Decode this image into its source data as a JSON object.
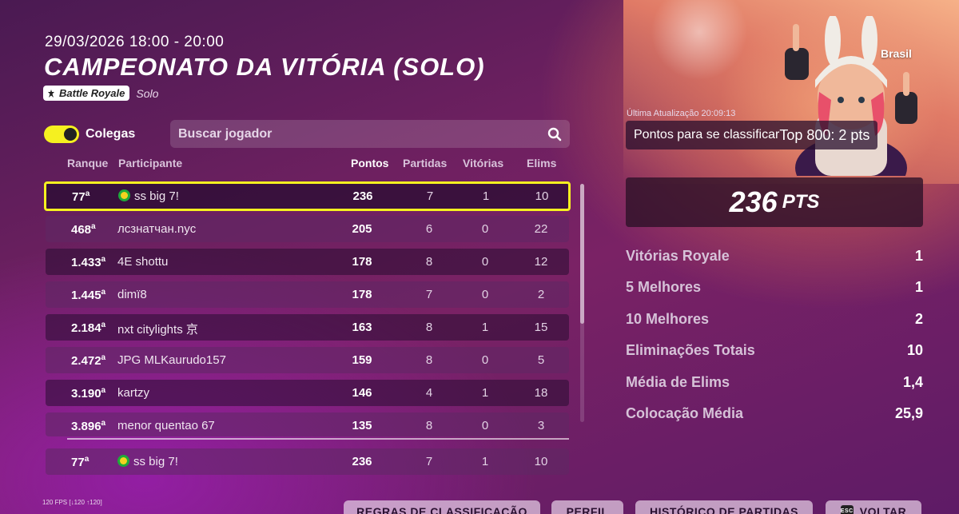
{
  "event": {
    "date": "29/03/2026 18:00 - 20:00",
    "title": "CAMPEONATO DA VITÓRIA (SOLO)",
    "mode_badge": "Battle Royale",
    "mode_sub": "Solo"
  },
  "filters": {
    "toggle_label": "Colegas",
    "toggle_on": true,
    "search_placeholder": "Buscar jogador"
  },
  "table": {
    "headers": {
      "rank": "Ranque",
      "participant": "Participante",
      "points": "Pontos",
      "matches": "Partidas",
      "wins": "Vitórias",
      "elims": "Elims"
    },
    "rows": [
      {
        "rank": "77",
        "name": "ss big 7!",
        "points": "236",
        "matches": "7",
        "wins": "1",
        "elims": "10"
      },
      {
        "rank": "468",
        "name": "лсзнатчан.nyc",
        "points": "205",
        "matches": "6",
        "wins": "0",
        "elims": "22"
      },
      {
        "rank": "1.433",
        "name": "4E shottu",
        "points": "178",
        "matches": "8",
        "wins": "0",
        "elims": "12"
      },
      {
        "rank": "1.445",
        "name": "dimï8",
        "points": "178",
        "matches": "7",
        "wins": "0",
        "elims": "2"
      },
      {
        "rank": "2.184",
        "name": "nxt citylights 京",
        "points": "163",
        "matches": "8",
        "wins": "1",
        "elims": "15"
      },
      {
        "rank": "2.472",
        "name": "JPG MLKaurudo157",
        "points": "159",
        "matches": "8",
        "wins": "0",
        "elims": "5"
      },
      {
        "rank": "3.190",
        "name": "kartzy",
        "points": "146",
        "matches": "4",
        "wins": "1",
        "elims": "18"
      },
      {
        "rank": "3.896",
        "name": "menor quentao 67",
        "points": "135",
        "matches": "8",
        "wins": "0",
        "elims": "3"
      }
    ],
    "ordinal_suffix": "a",
    "me": {
      "rank": "77",
      "name": "ss big 7!",
      "points": "236",
      "matches": "7",
      "wins": "1",
      "elims": "10"
    }
  },
  "summary": {
    "region": "Brasil",
    "last_update": "Última Atualização 20:09:13",
    "qualify_label": "Pontos para se classificar",
    "qualify_value": "Top 800: 2 pts",
    "points_num": "236",
    "points_unit": "PTS",
    "stats": [
      {
        "label": "Vitórias Royale",
        "value": "1"
      },
      {
        "label": "5 Melhores",
        "value": "1"
      },
      {
        "label": "10 Melhores",
        "value": "2"
      },
      {
        "label": "Eliminações Totais",
        "value": "10"
      },
      {
        "label": "Média de Elims",
        "value": "1,4"
      },
      {
        "label": "Colocação Média",
        "value": "25,9"
      }
    ]
  },
  "footer": {
    "fps": "120 FPS [↓120 ↑120]",
    "rules_button": "REGRAS DE CLASSIFICAÇÃO",
    "profile_button": "PERFIL",
    "history_button": "HISTÓRICO DE PARTIDAS",
    "esc_key": "ESC",
    "back_button": "VOLTAR"
  },
  "colors": {
    "highlight": "#f5f020",
    "toggle": "#f5f020"
  },
  "icons": {
    "search": "search-icon",
    "mode": "battle-royale-icon",
    "flag": "brazil-flag-icon"
  }
}
